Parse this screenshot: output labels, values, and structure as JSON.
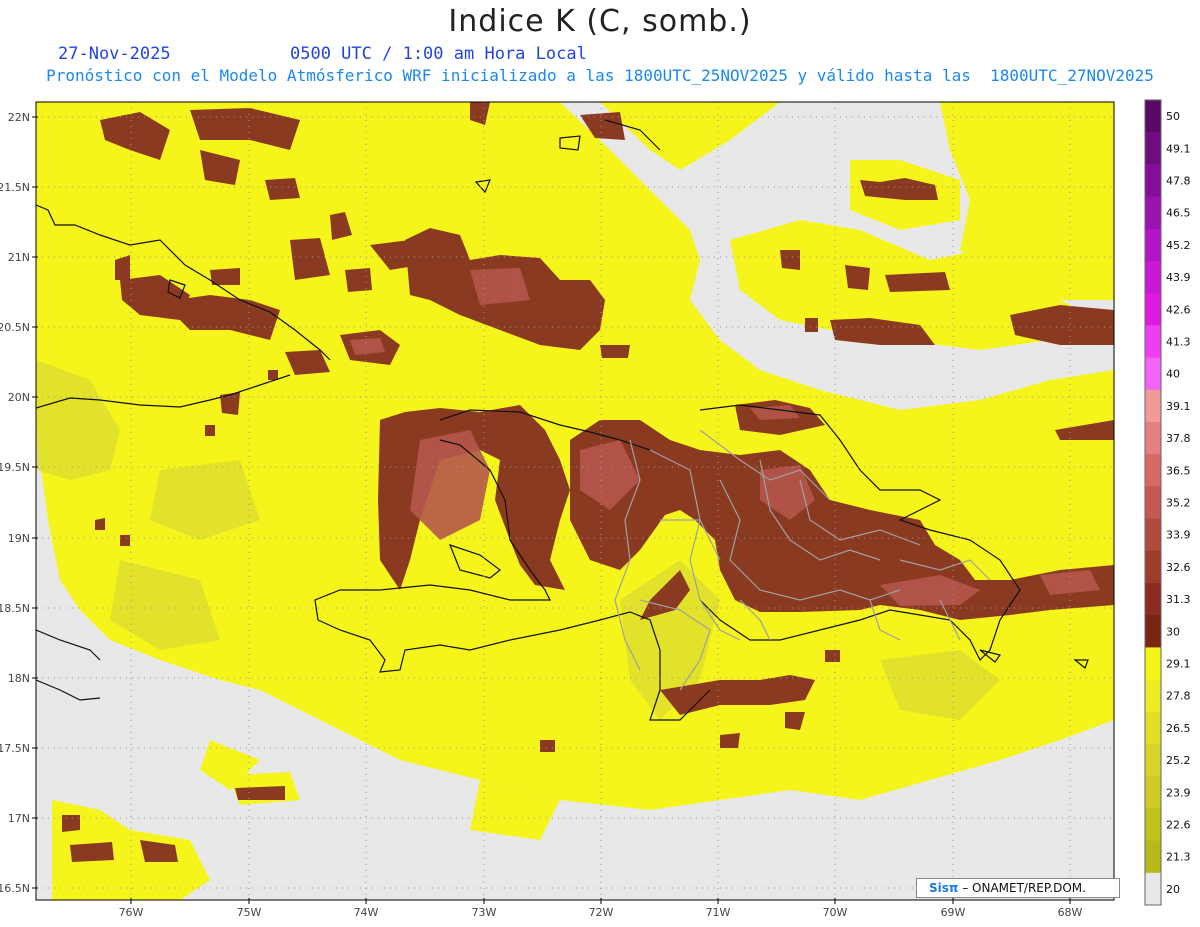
{
  "header": {
    "title": "Indice K (C, somb.)",
    "date": "27-Nov-2025",
    "time": "0500 UTC / 1:00 am Hora Local",
    "subtitle": "Pronóstico con el Modelo Atmósferico WRF inicializado a las 1800UTC_25NOV2025 y válido hasta las  1800UTC_27NOV2025"
  },
  "axes": {
    "lat_labels": [
      "22N",
      "21.5N",
      "21N",
      "20.5N",
      "20N",
      "19.5N",
      "19N",
      "18.5N",
      "18N",
      "17.5N",
      "17N",
      "16.5N"
    ],
    "lon_labels": [
      "76W",
      "75W",
      "74W",
      "73W",
      "72W",
      "71W",
      "70W",
      "69W",
      "68W"
    ]
  },
  "colorbar": {
    "labels": [
      "50",
      "49.1",
      "47.8",
      "46.5",
      "45.2",
      "43.9",
      "42.6",
      "41.3",
      "40",
      "39.1",
      "37.8",
      "36.5",
      "35.2",
      "33.9",
      "32.6",
      "31.3",
      "30",
      "29.1",
      "27.8",
      "26.5",
      "25.2",
      "23.9",
      "22.6",
      "21.3",
      "20"
    ],
    "colors": [
      "#5a0a66",
      "#6f0d80",
      "#860f99",
      "#9a12b0",
      "#b214c6",
      "#c917d6",
      "#de1ae0",
      "#ef3ef0",
      "#f463f8",
      "#f29a9a",
      "#e48080",
      "#d46a64",
      "#c25a50",
      "#b04a3c",
      "#9e3c2c",
      "#8b2c1e",
      "#7a2412",
      "#f6f614",
      "#ecec20",
      "#e0e028",
      "#d6d62a",
      "#cccc22",
      "#c2c21c",
      "#b8b818",
      "#e8e8e8"
    ]
  },
  "map_colors": {
    "background": "#e8e8e8",
    "yellow": "#f5f51c",
    "olive": "#dada30",
    "brown": "#8b3a22",
    "brown_inner": "#b5564a",
    "coast": "#111111",
    "borders": "#a0a0a0"
  },
  "credit": {
    "brand": "Sisπ",
    "text": "– ONAMET/REP.DOM."
  }
}
